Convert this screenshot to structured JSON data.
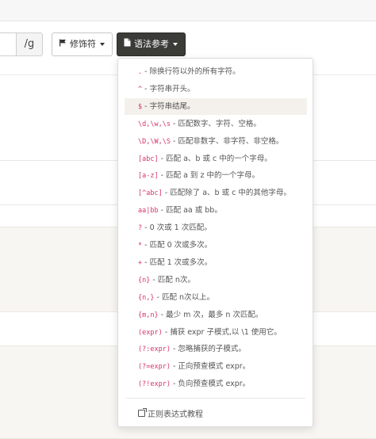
{
  "toolbar": {
    "flags": "/g",
    "modifier_label": "修饰符",
    "modifier_icon": "flag-icon",
    "syntax_label": "语法参考",
    "syntax_icon": "document-icon"
  },
  "syntax_menu": {
    "items": [
      {
        "code": ".",
        "desc": "除换行符以外的所有字符。"
      },
      {
        "code": "^",
        "desc": "字符串开头。"
      },
      {
        "code": "$",
        "desc": "字符串结尾。"
      },
      {
        "code": "\\d,\\w,\\s",
        "desc": "匹配数字、字符、空格。"
      },
      {
        "code": "\\D,\\W,\\S",
        "desc": "匹配非数字、非字符、非空格。"
      },
      {
        "code": "[abc]",
        "desc": "匹配 a、b 或 c 中的一个字母。"
      },
      {
        "code": "[a-z]",
        "desc": "匹配 a 到 z 中的一个字母。"
      },
      {
        "code": "[^abc]",
        "desc": "匹配除了 a、b 或 c 中的其他字母。"
      },
      {
        "code": "aa|bb",
        "desc": "匹配 aa 或 bb。"
      },
      {
        "code": "?",
        "desc": "0 次或 1 次匹配。"
      },
      {
        "code": "*",
        "desc": "匹配 0 次或多次。"
      },
      {
        "code": "+",
        "desc": "匹配 1 次或多次。"
      },
      {
        "code": "{n}",
        "desc": "匹配 n次。"
      },
      {
        "code": "{n,}",
        "desc": "匹配 n次以上。"
      },
      {
        "code": "{m,n}",
        "desc": "最少 m 次，最多 n 次匹配。"
      },
      {
        "code": "(expr)",
        "desc": "捕获 expr 子模式,以 \\1 使用它。"
      },
      {
        "code": "(?:expr)",
        "desc": "忽略捕获的子模式。"
      },
      {
        "code": "(?=expr)",
        "desc": "正向预查模式 expr。"
      },
      {
        "code": "(?!expr)",
        "desc": "负向预查模式 expr。"
      }
    ],
    "active_index": 2,
    "tutorial_link": "正则表达式教程",
    "tutorial_icon": "external-link-icon"
  },
  "colors": {
    "code": "#d6336c",
    "active_bg": "#f4f1ec",
    "syntax_button_bg": "#3b3b38"
  }
}
